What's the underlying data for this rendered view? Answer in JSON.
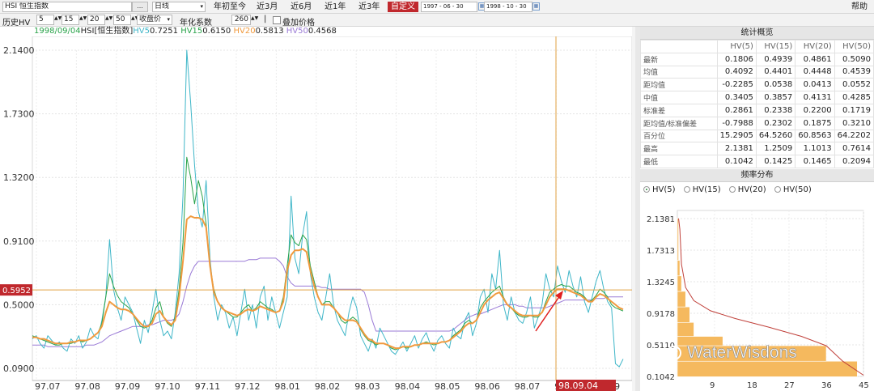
{
  "toolbar": {
    "security": "HSI  恒生指数",
    "browse_btn": "...",
    "period_select": "日线",
    "periods": [
      "年初至今",
      "近3月",
      "近6月",
      "近1年",
      "近3年"
    ],
    "active_period": "自定义",
    "date_from": "1997 - 06 - 30",
    "date_to": "1998 - 10 - 30",
    "calendar_icon": "calendar-icon",
    "help": "帮助"
  },
  "params": {
    "hv_label": "历史HV",
    "windows": [
      "5",
      "15",
      "20",
      "50"
    ],
    "price_select": "收盘价",
    "annual_label": "年化系数",
    "annual_value": "260",
    "separator": "|",
    "overlay_label": "叠加价格"
  },
  "legend": {
    "date": "1998/09/04",
    "name": "HSI[恒生指数]",
    "items": [
      {
        "label": "HV5",
        "value": "0.7251",
        "color": "#3fb6c8"
      },
      {
        "label": "HV15",
        "value": "0.6150",
        "color": "#2aa34a"
      },
      {
        "label": "HV20",
        "value": "0.5813",
        "color": "#f09a3e"
      },
      {
        "label": "HV50",
        "value": "0.4568",
        "color": "#9a7ad6"
      }
    ]
  },
  "crosshair": {
    "value_label": "0.5952",
    "date_label": "98.09.04"
  },
  "watermark": "WaterWisdons",
  "chart_data": [
    {
      "type": "line",
      "title": "",
      "y_ticks": [
        "2.1400",
        "1.7300",
        "1.3200",
        "0.9100",
        "0.5000",
        "0.0900"
      ],
      "ylim": [
        0.09,
        2.14
      ],
      "x_ticks": [
        "97.07",
        "97.08",
        "97.09",
        "97.10",
        "97.11",
        "97.12",
        "98.01",
        "98.02",
        "98.03",
        "98.04",
        "98.05",
        "98.06",
        "98.07",
        "98.08",
        "98.09"
      ],
      "grid": true,
      "series": [
        {
          "name": "HV5",
          "values": [
            0.28,
            0.3,
            0.25,
            0.22,
            0.3,
            0.27,
            0.24,
            0.26,
            0.22,
            0.2,
            0.28,
            0.25,
            0.3,
            0.22,
            0.26,
            0.35,
            0.3,
            0.28,
            0.4,
            0.55,
            0.92,
            0.6,
            0.48,
            0.4,
            0.55,
            0.5,
            0.45,
            0.35,
            0.25,
            0.4,
            0.32,
            0.45,
            0.6,
            0.4,
            0.3,
            0.33,
            0.28,
            0.45,
            0.7,
            1.2,
            2.14,
            1.8,
            1.4,
            1.1,
            1.0,
            1.3,
            0.8,
            0.55,
            0.4,
            0.5,
            0.45,
            0.35,
            0.42,
            0.3,
            0.45,
            0.6,
            0.4,
            0.5,
            0.35,
            0.55,
            0.62,
            0.4,
            0.55,
            0.45,
            0.35,
            0.45,
            0.55,
            1.2,
            0.8,
            0.7,
            0.95,
            1.1,
            0.7,
            0.55,
            0.45,
            0.4,
            0.55,
            0.7,
            0.5,
            0.4,
            0.35,
            0.3,
            0.45,
            0.55,
            0.48,
            0.3,
            0.25,
            0.2,
            0.28,
            0.22,
            0.35,
            0.3,
            0.25,
            0.2,
            0.18,
            0.22,
            0.26,
            0.2,
            0.25,
            0.3,
            0.22,
            0.28,
            0.32,
            0.25,
            0.2,
            0.27,
            0.3,
            0.25,
            0.22,
            0.35,
            0.3,
            0.28,
            0.4,
            0.45,
            0.3,
            0.38,
            0.55,
            0.6,
            0.45,
            0.7,
            0.6,
            0.85,
            0.5,
            0.4,
            0.55,
            0.45,
            0.4,
            0.38,
            0.45,
            0.55,
            0.35,
            0.42,
            0.5,
            0.7,
            0.6,
            0.55,
            0.75,
            0.65,
            0.58,
            0.72,
            0.62,
            0.55,
            0.68,
            0.52,
            0.45,
            0.55,
            0.65,
            0.72,
            0.6,
            0.52,
            0.48,
            0.12,
            0.1,
            0.15
          ]
        },
        {
          "name": "HV15",
          "values": [
            0.3,
            0.29,
            0.28,
            0.27,
            0.26,
            0.25,
            0.24,
            0.24,
            0.25,
            0.25,
            0.25,
            0.26,
            0.27,
            0.26,
            0.27,
            0.28,
            0.3,
            0.32,
            0.38,
            0.55,
            0.7,
            0.62,
            0.56,
            0.52,
            0.5,
            0.48,
            0.44,
            0.4,
            0.36,
            0.35,
            0.36,
            0.4,
            0.48,
            0.52,
            0.42,
            0.38,
            0.36,
            0.42,
            0.6,
            0.9,
            1.45,
            1.32,
            1.15,
            1.3,
            1.2,
            1.02,
            0.75,
            0.6,
            0.52,
            0.48,
            0.46,
            0.44,
            0.42,
            0.42,
            0.45,
            0.48,
            0.5,
            0.46,
            0.48,
            0.52,
            0.5,
            0.48,
            0.47,
            0.45,
            0.46,
            0.55,
            0.75,
            0.95,
            0.9,
            0.88,
            0.95,
            0.92,
            0.75,
            0.65,
            0.55,
            0.5,
            0.52,
            0.52,
            0.48,
            0.45,
            0.4,
            0.38,
            0.4,
            0.42,
            0.4,
            0.34,
            0.3,
            0.27,
            0.26,
            0.24,
            0.25,
            0.25,
            0.24,
            0.22,
            0.21,
            0.22,
            0.23,
            0.22,
            0.23,
            0.24,
            0.24,
            0.25,
            0.26,
            0.25,
            0.24,
            0.25,
            0.26,
            0.26,
            0.27,
            0.3,
            0.32,
            0.34,
            0.38,
            0.4,
            0.38,
            0.4,
            0.48,
            0.52,
            0.55,
            0.58,
            0.6,
            0.62,
            0.55,
            0.5,
            0.48,
            0.45,
            0.43,
            0.42,
            0.42,
            0.43,
            0.42,
            0.42,
            0.45,
            0.52,
            0.58,
            0.6,
            0.62,
            0.63,
            0.62,
            0.62,
            0.6,
            0.58,
            0.57,
            0.55,
            0.52,
            0.53,
            0.56,
            0.6,
            0.58,
            0.55,
            0.5,
            0.48,
            0.47,
            0.46
          ]
        },
        {
          "name": "HV20",
          "values": [
            0.29,
            0.29,
            0.28,
            0.28,
            0.27,
            0.26,
            0.25,
            0.25,
            0.25,
            0.25,
            0.26,
            0.26,
            0.27,
            0.27,
            0.27,
            0.28,
            0.3,
            0.32,
            0.36,
            0.45,
            0.52,
            0.5,
            0.48,
            0.47,
            0.47,
            0.46,
            0.44,
            0.41,
            0.38,
            0.36,
            0.36,
            0.38,
            0.44,
            0.46,
            0.42,
            0.39,
            0.37,
            0.4,
            0.55,
            0.78,
            1.05,
            1.07,
            1.06,
            1.06,
            1.05,
            1.0,
            0.75,
            0.58,
            0.52,
            0.48,
            0.46,
            0.45,
            0.44,
            0.43,
            0.44,
            0.46,
            0.47,
            0.46,
            0.47,
            0.49,
            0.48,
            0.47,
            0.46,
            0.45,
            0.46,
            0.52,
            0.72,
            0.82,
            0.85,
            0.85,
            0.86,
            0.84,
            0.72,
            0.62,
            0.55,
            0.5,
            0.5,
            0.5,
            0.48,
            0.45,
            0.42,
            0.4,
            0.4,
            0.4,
            0.39,
            0.35,
            0.31,
            0.28,
            0.27,
            0.25,
            0.25,
            0.25,
            0.24,
            0.23,
            0.22,
            0.22,
            0.23,
            0.23,
            0.23,
            0.24,
            0.24,
            0.25,
            0.25,
            0.25,
            0.25,
            0.25,
            0.26,
            0.26,
            0.27,
            0.29,
            0.31,
            0.33,
            0.36,
            0.38,
            0.38,
            0.4,
            0.45,
            0.5,
            0.53,
            0.55,
            0.57,
            0.58,
            0.54,
            0.5,
            0.48,
            0.46,
            0.44,
            0.43,
            0.43,
            0.43,
            0.43,
            0.43,
            0.45,
            0.5,
            0.55,
            0.58,
            0.6,
            0.6,
            0.6,
            0.59,
            0.58,
            0.57,
            0.56,
            0.54,
            0.52,
            0.52,
            0.55,
            0.57,
            0.56,
            0.54,
            0.52,
            0.5,
            0.48,
            0.47
          ]
        },
        {
          "name": "HV50",
          "values": [
            0.24,
            0.24,
            0.24,
            0.24,
            0.23,
            0.23,
            0.23,
            0.23,
            0.23,
            0.23,
            0.23,
            0.23,
            0.23,
            0.23,
            0.24,
            0.24,
            0.24,
            0.25,
            0.26,
            0.28,
            0.3,
            0.31,
            0.32,
            0.33,
            0.34,
            0.35,
            0.36,
            0.36,
            0.36,
            0.36,
            0.37,
            0.37,
            0.38,
            0.39,
            0.4,
            0.4,
            0.4,
            0.41,
            0.44,
            0.52,
            0.62,
            0.7,
            0.75,
            0.78,
            0.78,
            0.78,
            0.78,
            0.78,
            0.78,
            0.78,
            0.78,
            0.78,
            0.78,
            0.78,
            0.78,
            0.78,
            0.79,
            0.79,
            0.79,
            0.8,
            0.8,
            0.8,
            0.8,
            0.8,
            0.78,
            0.75,
            0.68,
            0.64,
            0.62,
            0.62,
            0.62,
            0.62,
            0.62,
            0.62,
            0.62,
            0.61,
            0.61,
            0.6,
            0.6,
            0.6,
            0.6,
            0.6,
            0.6,
            0.6,
            0.6,
            0.6,
            0.58,
            0.5,
            0.4,
            0.33,
            0.33,
            0.33,
            0.33,
            0.33,
            0.33,
            0.33,
            0.33,
            0.33,
            0.33,
            0.33,
            0.33,
            0.33,
            0.33,
            0.33,
            0.33,
            0.33,
            0.33,
            0.33,
            0.33,
            0.34,
            0.36,
            0.38,
            0.4,
            0.42,
            0.43,
            0.44,
            0.44,
            0.45,
            0.46,
            0.47,
            0.48,
            0.49,
            0.5,
            0.5,
            0.5,
            0.5,
            0.49,
            0.49,
            0.48,
            0.48,
            0.48,
            0.48,
            0.48,
            0.48,
            0.49,
            0.5,
            0.51,
            0.52,
            0.53,
            0.53,
            0.53,
            0.53,
            0.53,
            0.53,
            0.53,
            0.53,
            0.54,
            0.54,
            0.54,
            0.55,
            0.55,
            0.55,
            0.55,
            0.55
          ]
        }
      ]
    },
    {
      "type": "area",
      "y_ticks": [
        "2.1381",
        "1.7313",
        "1.3245",
        "0.9178",
        "0.5110",
        "0.1042"
      ],
      "ylim": [
        0.1042,
        2.1381
      ],
      "x_ticks": [
        "9",
        "18",
        "27",
        "36",
        "45"
      ],
      "xlim": [
        0,
        45
      ]
    }
  ],
  "stats": {
    "title": "统计概览",
    "columns": [
      "HV(5)",
      "HV(15)",
      "HV(20)",
      "HV(50)"
    ],
    "rows": [
      {
        "label": "最新",
        "values": [
          "0.1806",
          "0.4939",
          "0.4861",
          "0.5090"
        ]
      },
      {
        "label": "均值",
        "values": [
          "0.4092",
          "0.4401",
          "0.4448",
          "0.4539"
        ]
      },
      {
        "label": "距均值",
        "values": [
          "-0.2285",
          "0.0538",
          "0.0413",
          "0.0552"
        ]
      },
      {
        "label": "中值",
        "values": [
          "0.3405",
          "0.3857",
          "0.4131",
          "0.4285"
        ]
      },
      {
        "label": "标准差",
        "values": [
          "0.2861",
          "0.2338",
          "0.2200",
          "0.1719"
        ]
      },
      {
        "label": "距均值/标准偏差",
        "values": [
          "-0.7988",
          "0.2302",
          "0.1875",
          "0.3210"
        ]
      },
      {
        "label": "百分位",
        "values": [
          "15.2905",
          "64.5260",
          "60.8563",
          "64.2202"
        ]
      },
      {
        "label": "最高",
        "values": [
          "2.1381",
          "1.2509",
          "1.1013",
          "0.7614"
        ]
      },
      {
        "label": "最低",
        "values": [
          "0.1042",
          "0.1425",
          "0.1465",
          "0.2094"
        ]
      }
    ]
  },
  "freq": {
    "title": "频率分布",
    "options": [
      "HV(5)",
      "HV(15)",
      "HV(20)",
      "HV(50)"
    ],
    "selected": "HV(5)"
  },
  "colors": {
    "accent_red": "#c0282d",
    "crosshair": "#e0a040",
    "bar_fill": "#f5b95e"
  }
}
